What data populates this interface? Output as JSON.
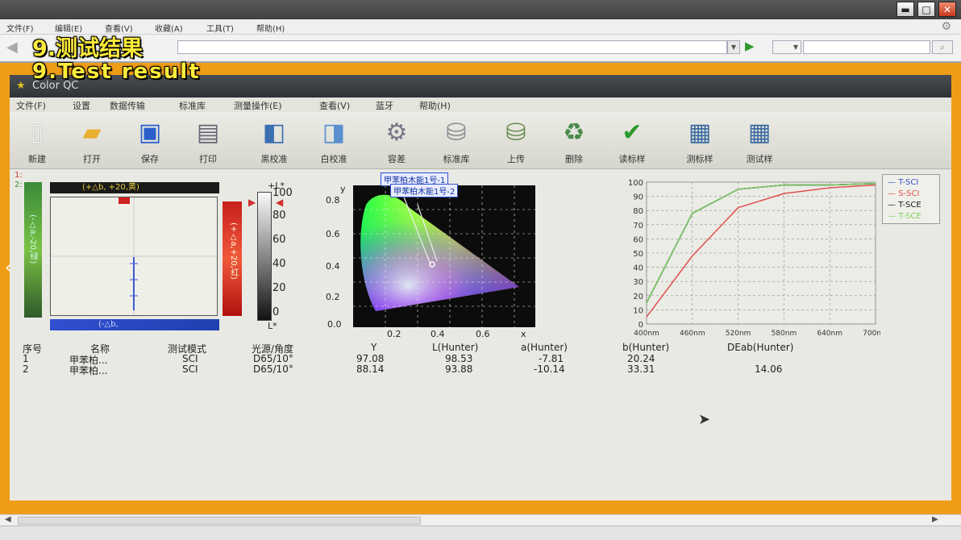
{
  "browser": {
    "menu": [
      "文件(F)",
      "编辑(E)",
      "查看(V)",
      "收藏(A)",
      "工具(T)",
      "帮助(H)"
    ],
    "window_buttons": {
      "minimize": "▬",
      "maximize": "□",
      "close": "✕"
    }
  },
  "captions": {
    "zh": "9.测试结果",
    "en": "9.Test result"
  },
  "app": {
    "title": "Color QC",
    "menu": [
      "文件(F)",
      "设置",
      "数据传输",
      "标准库",
      "测量操作(E)",
      "查看(V)",
      "蓝牙",
      "帮助(H)"
    ],
    "toolbar": [
      {
        "label": "新建",
        "icon": "new-file-icon"
      },
      {
        "label": "打开",
        "icon": "open-folder-icon"
      },
      {
        "label": "保存",
        "icon": "save-disk-icon"
      },
      {
        "label": "打印",
        "icon": "printer-icon"
      },
      {
        "label": "黑校准",
        "icon": "black-calibration-icon"
      },
      {
        "label": "白校准",
        "icon": "white-calibration-icon"
      },
      {
        "label": "容差",
        "icon": "tolerance-gear-icon"
      },
      {
        "label": "标准库",
        "icon": "database-icon"
      },
      {
        "label": "上传",
        "icon": "upload-database-icon"
      },
      {
        "label": "删除",
        "icon": "recycle-icon"
      },
      {
        "label": "读标样",
        "icon": "checkmark-icon"
      },
      {
        "label": "测标样",
        "icon": "measure-standard-icon"
      },
      {
        "label": "测试样",
        "icon": "measure-sample-icon"
      }
    ]
  },
  "panels": {
    "ab": {
      "top_label": "(+△b, +20,黄)",
      "bottom_label": "(-△b,",
      "left_label": "(-△a,-20,绿)",
      "right_label": "(+△a,+20,红)",
      "marks": [
        "1:",
        "2:"
      ]
    },
    "lightness": {
      "label_top": "+L*",
      "label_bottom": "L*",
      "ticks": [
        "100",
        "80",
        "60",
        "40",
        "20",
        "0"
      ]
    },
    "cie": {
      "labels": [
        "甲苯柏木能1号-1",
        "甲苯柏木能1号-2"
      ],
      "y_label": "y",
      "x_label": "x",
      "y_ticks": [
        "0.8",
        "0.6",
        "0.4",
        "0.2",
        "0.0"
      ],
      "x_ticks": [
        "0.2",
        "0.4",
        "0.6"
      ]
    }
  },
  "chart_data": {
    "type": "line",
    "title": "",
    "xlabel": "",
    "ylabel": "",
    "x": [
      "400nm",
      "460nm",
      "520nm",
      "580nm",
      "640nm",
      "700nm"
    ],
    "ylim": [
      0,
      100
    ],
    "y_ticks": [
      0,
      10,
      20,
      30,
      40,
      50,
      60,
      70,
      80,
      90,
      100
    ],
    "grid": true,
    "legend": "top-right",
    "series": [
      {
        "name": "T-SCI",
        "color": "#3a4fc8",
        "values": [
          15,
          78,
          95,
          98,
          98,
          99
        ]
      },
      {
        "name": "S-SCI",
        "color": "#e05050",
        "values": [
          5,
          48,
          82,
          92,
          96,
          98
        ]
      },
      {
        "name": "T-SCE",
        "color": "#1a1a1a",
        "values": [
          15,
          78,
          95,
          98,
          98,
          99
        ]
      },
      {
        "name": "T-SCE",
        "color": "#7fd060",
        "values": [
          15,
          78,
          95,
          98,
          98,
          99
        ]
      }
    ]
  },
  "table": {
    "headers": [
      "序号",
      "名称",
      "测试模式",
      "光源/角度",
      "Y",
      "L(Hunter)",
      "a(Hunter)",
      "b(Hunter)",
      "DEab(Hunter)"
    ],
    "rows": [
      [
        "1",
        "甲苯柏...",
        "SCI",
        "D65/10°",
        "97.08",
        "98.53",
        "-7.81",
        "20.24",
        ""
      ],
      [
        "2",
        "甲苯柏...",
        "SCI",
        "D65/10°",
        "88.14",
        "93.88",
        "-10.14",
        "33.31",
        "14.06"
      ]
    ]
  }
}
